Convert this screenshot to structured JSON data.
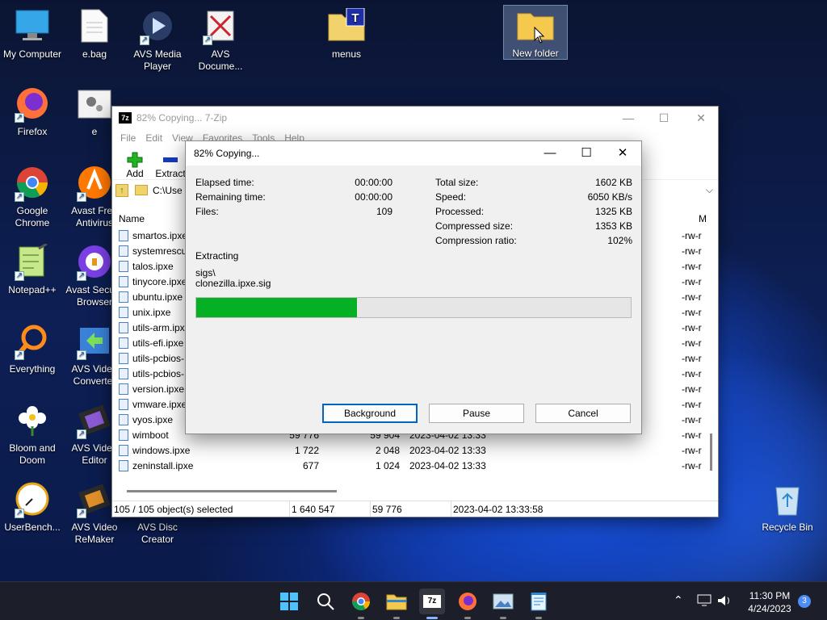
{
  "desktop": {
    "icons": [
      {
        "label": "My Computer"
      },
      {
        "label": "e.bag"
      },
      {
        "label": "AVS Media Player"
      },
      {
        "label": "AVS Docume..."
      },
      {
        "label": "menus"
      },
      {
        "label": "New folder"
      },
      {
        "label": "Firefox"
      },
      {
        "label": "e"
      },
      {
        "label": "Google Chrome"
      },
      {
        "label": "Avast Free Antivirus"
      },
      {
        "label": "Notepad++"
      },
      {
        "label": "Avast Secure Browser"
      },
      {
        "label": "Everything"
      },
      {
        "label": "AVS Video Converter"
      },
      {
        "label": "Bloom and Doom"
      },
      {
        "label": "AVS Video Editor"
      },
      {
        "label": "UserBench..."
      },
      {
        "label": "AVS Video ReMaker"
      },
      {
        "label": "AVS Disc Creator"
      },
      {
        "label": "Recycle Bin"
      }
    ]
  },
  "main_window": {
    "title": "82% Copying... 7-Zip",
    "menu": [
      "File",
      "Edit",
      "View",
      "Favorites",
      "Tools",
      "Help"
    ],
    "toolbar": {
      "add": "Add",
      "extract": "Extract"
    },
    "address": "C:\\Use",
    "columns": {
      "name": "Name",
      "attr": "M"
    },
    "files": [
      {
        "name": "smartos.ipxe",
        "size": "",
        "packed": "",
        "modified": "",
        "attr": "-rw-r"
      },
      {
        "name": "systemrescue",
        "size": "",
        "packed": "",
        "modified": "",
        "attr": "-rw-r"
      },
      {
        "name": "talos.ipxe",
        "size": "",
        "packed": "",
        "modified": "",
        "attr": "-rw-r"
      },
      {
        "name": "tinycore.ipxe",
        "size": "",
        "packed": "",
        "modified": "",
        "attr": "-rw-r"
      },
      {
        "name": "ubuntu.ipxe",
        "size": "",
        "packed": "",
        "modified": "",
        "attr": "-rw-r"
      },
      {
        "name": "unix.ipxe",
        "size": "",
        "packed": "",
        "modified": "",
        "attr": "-rw-r"
      },
      {
        "name": "utils-arm.ipx",
        "size": "",
        "packed": "",
        "modified": "",
        "attr": "-rw-r"
      },
      {
        "name": "utils-efi.ipxe",
        "size": "",
        "packed": "",
        "modified": "",
        "attr": "-rw-r"
      },
      {
        "name": "utils-pcbios-",
        "size": "",
        "packed": "",
        "modified": "",
        "attr": "-rw-r"
      },
      {
        "name": "utils-pcbios-",
        "size": "",
        "packed": "",
        "modified": "",
        "attr": "-rw-r"
      },
      {
        "name": "version.ipxe",
        "size": "",
        "packed": "",
        "modified": "",
        "attr": "-rw-r"
      },
      {
        "name": "vmware.ipxe",
        "size": "",
        "packed": "",
        "modified": "",
        "attr": "-rw-r"
      },
      {
        "name": "vyos.ipxe",
        "size": "",
        "packed": "",
        "modified": "",
        "attr": "-rw-r"
      },
      {
        "name": "wimboot",
        "size": "59 776",
        "packed": "59 904",
        "modified": "2023-04-02 13:33",
        "attr": "-rw-r"
      },
      {
        "name": "windows.ipxe",
        "size": "1 722",
        "packed": "2 048",
        "modified": "2023-04-02 13:33",
        "attr": "-rw-r"
      },
      {
        "name": "zeninstall.ipxe",
        "size": "677",
        "packed": "1 024",
        "modified": "2023-04-02 13:33",
        "attr": "-rw-r"
      }
    ],
    "status": {
      "selected": "105 / 105 object(s) selected",
      "total": "1 640 547",
      "size": "59 776",
      "date": "2023-04-02 13:33:58"
    }
  },
  "dialog": {
    "title": "82% Copying...",
    "elapsed_label": "Elapsed time:",
    "elapsed": "00:00:00",
    "remaining_label": "Remaining time:",
    "remaining": "00:00:00",
    "files_label": "Files:",
    "files": "109",
    "total_size_label": "Total size:",
    "total_size": "1602 KB",
    "speed_label": "Speed:",
    "speed": "6050 KB/s",
    "processed_label": "Processed:",
    "processed": "1325 KB",
    "compressed_label": "Compressed size:",
    "compressed": "1353 KB",
    "ratio_label": "Compression ratio:",
    "ratio": "102%",
    "operation": "Extracting",
    "path_line1": "sigs\\",
    "path_line2": "clonezilla.ipxe.sig",
    "progress_fraction": 0.37,
    "buttons": {
      "background": "Background",
      "pause": "Pause",
      "cancel": "Cancel"
    }
  },
  "taskbar": {
    "time": "11:30 PM",
    "date": "4/24/2023",
    "notifications": "3"
  },
  "colors": {
    "progress": "#06b025",
    "accent": "#0067c0"
  }
}
